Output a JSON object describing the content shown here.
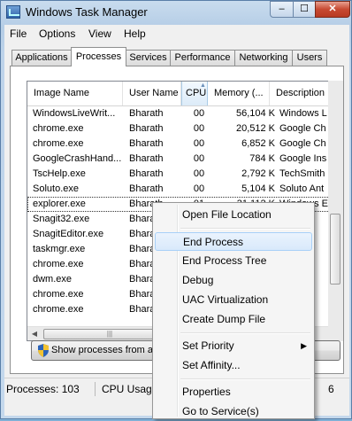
{
  "window": {
    "title": "Windows Task Manager",
    "min_glyph": "–",
    "max_glyph": "☐",
    "close_glyph": "✕"
  },
  "menubar": [
    "File",
    "Options",
    "View",
    "Help"
  ],
  "tabs": [
    "Applications",
    "Processes",
    "Services",
    "Performance",
    "Networking",
    "Users"
  ],
  "active_tab": "Processes",
  "columns": [
    "Image Name",
    "User Name",
    "CPU",
    "Memory (...",
    "Description"
  ],
  "sorted_column": "CPU",
  "processes": [
    {
      "name": "WindowsLiveWrit...",
      "user": "Bharath",
      "cpu": "00",
      "mem": "56,104 K",
      "desc": "Windows L"
    },
    {
      "name": "chrome.exe",
      "user": "Bharath",
      "cpu": "00",
      "mem": "20,512 K",
      "desc": "Google Ch"
    },
    {
      "name": "chrome.exe",
      "user": "Bharath",
      "cpu": "00",
      "mem": "6,852 K",
      "desc": "Google Ch"
    },
    {
      "name": "GoogleCrashHand...",
      "user": "Bharath",
      "cpu": "00",
      "mem": "784 K",
      "desc": "Google Ins"
    },
    {
      "name": "TscHelp.exe",
      "user": "Bharath",
      "cpu": "00",
      "mem": "2,792 K",
      "desc": "TechSmith"
    },
    {
      "name": "Soluto.exe",
      "user": "Bharath",
      "cpu": "00",
      "mem": "5,104 K",
      "desc": "Soluto Ant"
    },
    {
      "name": "explorer.exe",
      "user": "Bharath",
      "cpu": "01",
      "mem": "31,112 K",
      "desc": "Windows E"
    },
    {
      "name": "Snagit32.exe",
      "user": "Bharath",
      "cpu": "",
      "mem": "",
      "desc": ""
    },
    {
      "name": "SnagitEditor.exe",
      "user": "Bharath",
      "cpu": "",
      "mem": "",
      "desc": ""
    },
    {
      "name": "taskmgr.exe",
      "user": "Bharath",
      "cpu": "",
      "mem": "",
      "desc": ""
    },
    {
      "name": "chrome.exe",
      "user": "Bharath",
      "cpu": "",
      "mem": "",
      "desc": ""
    },
    {
      "name": "dwm.exe",
      "user": "Bharath",
      "cpu": "",
      "mem": "",
      "desc": ""
    },
    {
      "name": "chrome.exe",
      "user": "Bharath",
      "cpu": "",
      "mem": "",
      "desc": ""
    },
    {
      "name": "chrome.exe",
      "user": "Bharath",
      "cpu": "",
      "mem": "",
      "desc": ""
    }
  ],
  "selected_row_index": 6,
  "show_processes_button": "Show processes from all",
  "status": {
    "processes": "Processes: 103",
    "cpu": "CPU Usage",
    "mem_tail": "6"
  },
  "context_menu": [
    {
      "label": "Open File Location"
    },
    {
      "separator": true
    },
    {
      "label": "End Process",
      "hover": true
    },
    {
      "label": "End Process Tree"
    },
    {
      "label": "Debug"
    },
    {
      "label": "UAC Virtualization"
    },
    {
      "label": "Create Dump File"
    },
    {
      "separator": true
    },
    {
      "label": "Set Priority",
      "submenu": true
    },
    {
      "label": "Set Affinity..."
    },
    {
      "separator": true
    },
    {
      "label": "Properties"
    },
    {
      "label": "Go to Service(s)"
    }
  ],
  "colors": {
    "title_bg": "#b9d1ea",
    "close_red": "#c74a32",
    "hover_border": "#a8d0f7"
  }
}
